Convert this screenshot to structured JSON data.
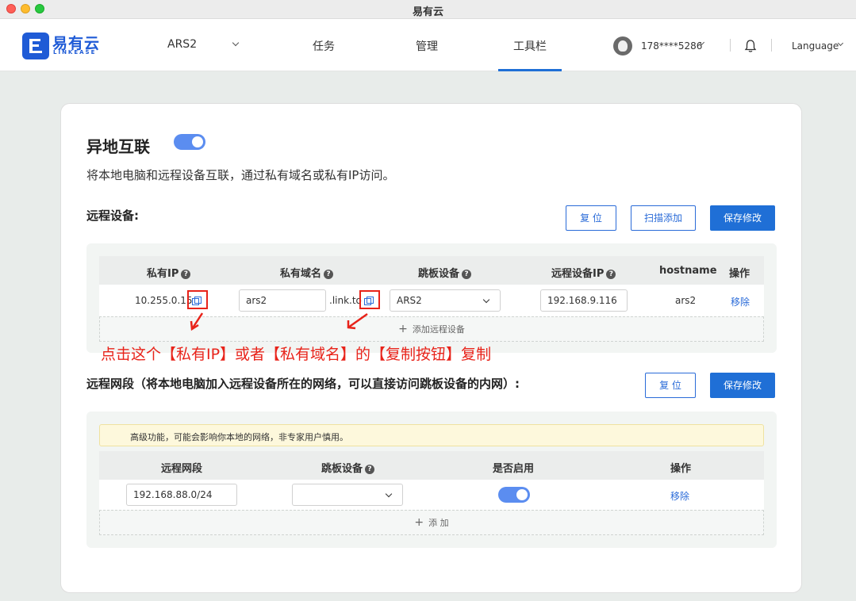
{
  "window": {
    "title": "易有云"
  },
  "nav": {
    "logo_text": "易有云",
    "logo_sub": "LINKEASE",
    "device": "ARS2",
    "tasks": "任务",
    "manage": "管理",
    "toolbar": "工具栏",
    "user": "178****5286",
    "language": "Language",
    "active_tab": "工具栏"
  },
  "page": {
    "title": "异地互联",
    "interconnect_enabled": true,
    "description": "将本地电脑和远程设备互联，通过私有域名或私有IP访问。"
  },
  "remote_devices": {
    "title": "远程设备:",
    "reset_label": "复 位",
    "scan_add_label": "扫描添加",
    "save_label": "保存修改",
    "columns": [
      "私有IP",
      "私有域名",
      "跳板设备",
      "远程设备IP",
      "hostname",
      "操作"
    ],
    "rows": [
      {
        "private_ip": "10.255.0.15",
        "domain_prefix": "ars2",
        "domain_suffix": ".link.to",
        "jump_device": "ARS2",
        "remote_ip": "192.168.9.116",
        "hostname": "ars2",
        "action": "移除"
      }
    ],
    "add_label": "添加远程设备"
  },
  "annotation": "点击这个【私有IP】或者【私有域名】的【复制按钮】复制",
  "remote_subnets": {
    "title": "远程网段（将本地电脑加入远程设备所在的网络，可以直接访问跳板设备的内网）:",
    "reset_label": "复 位",
    "save_label": "保存修改",
    "warning": "高级功能，可能会影响你本地的网络，非专家用户慎用。",
    "columns": [
      "远程网段",
      "跳板设备",
      "是否启用",
      "操作"
    ],
    "rows": [
      {
        "subnet": "192.168.88.0/24",
        "jump_device": "",
        "enabled": true,
        "action": "移除"
      }
    ],
    "add_label": "添 加"
  },
  "colors": {
    "accent": "#1f6fd6",
    "annotation": "#e8231a",
    "toggle": "#5b8df0"
  }
}
